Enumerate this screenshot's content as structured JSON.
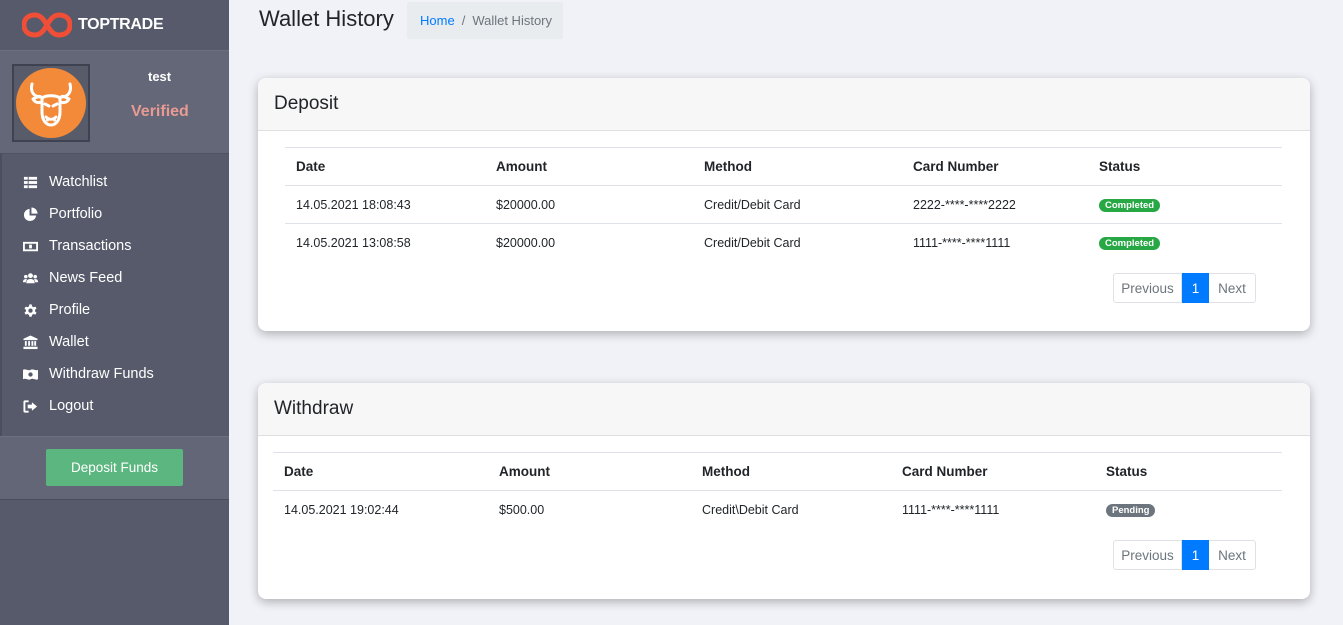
{
  "brand": {
    "name": "TOPTRADE"
  },
  "user": {
    "name": "test",
    "status": "Verified"
  },
  "sidebar": {
    "items": [
      {
        "label": "Watchlist",
        "icon": "th-list-icon"
      },
      {
        "label": "Portfolio",
        "icon": "pie-chart-icon"
      },
      {
        "label": "Transactions",
        "icon": "money-bill-icon"
      },
      {
        "label": "News Feed",
        "icon": "users-icon"
      },
      {
        "label": "Profile",
        "icon": "gear-icon"
      },
      {
        "label": "Wallet",
        "icon": "bank-icon"
      },
      {
        "label": "Withdraw Funds",
        "icon": "money-bill-wave-icon"
      },
      {
        "label": "Logout",
        "icon": "sign-out-icon"
      }
    ],
    "deposit_button": "Deposit Funds"
  },
  "header": {
    "title": "Wallet History",
    "breadcrumb": {
      "home": "Home",
      "separator": "/",
      "current": "Wallet History"
    }
  },
  "deposit": {
    "title": "Deposit",
    "columns": [
      "Date",
      "Amount",
      "Method",
      "Card Number",
      "Status"
    ],
    "rows": [
      {
        "date": "14.05.2021 18:08:43",
        "amount": "$20000.00",
        "method": "Credit/Debit Card",
        "card": "2222-****-****2222",
        "status": "Completed"
      },
      {
        "date": "14.05.2021 13:08:58",
        "amount": "$20000.00",
        "method": "Credit/Debit Card",
        "card": "1111-****-****1111",
        "status": "Completed"
      }
    ],
    "pagination": {
      "prev": "Previous",
      "page": "1",
      "next": "Next"
    }
  },
  "withdraw": {
    "title": "Withdraw",
    "columns": [
      "Date",
      "Amount",
      "Method",
      "Card Number",
      "Status"
    ],
    "rows": [
      {
        "date": "14.05.2021 19:02:44",
        "amount": "$500.00",
        "method": "Credit\\Debit Card",
        "card": "1111-****-****1111",
        "status": "Pending"
      }
    ],
    "pagination": {
      "prev": "Previous",
      "page": "1",
      "next": "Next"
    }
  },
  "colors": {
    "sidebar": "#565a6a",
    "accent": "#007bff",
    "success": "#28a745",
    "pending": "#6c757d",
    "deposit_button": "#5cb67f",
    "verified": "#e89a93",
    "avatar": "#f28a3a"
  }
}
